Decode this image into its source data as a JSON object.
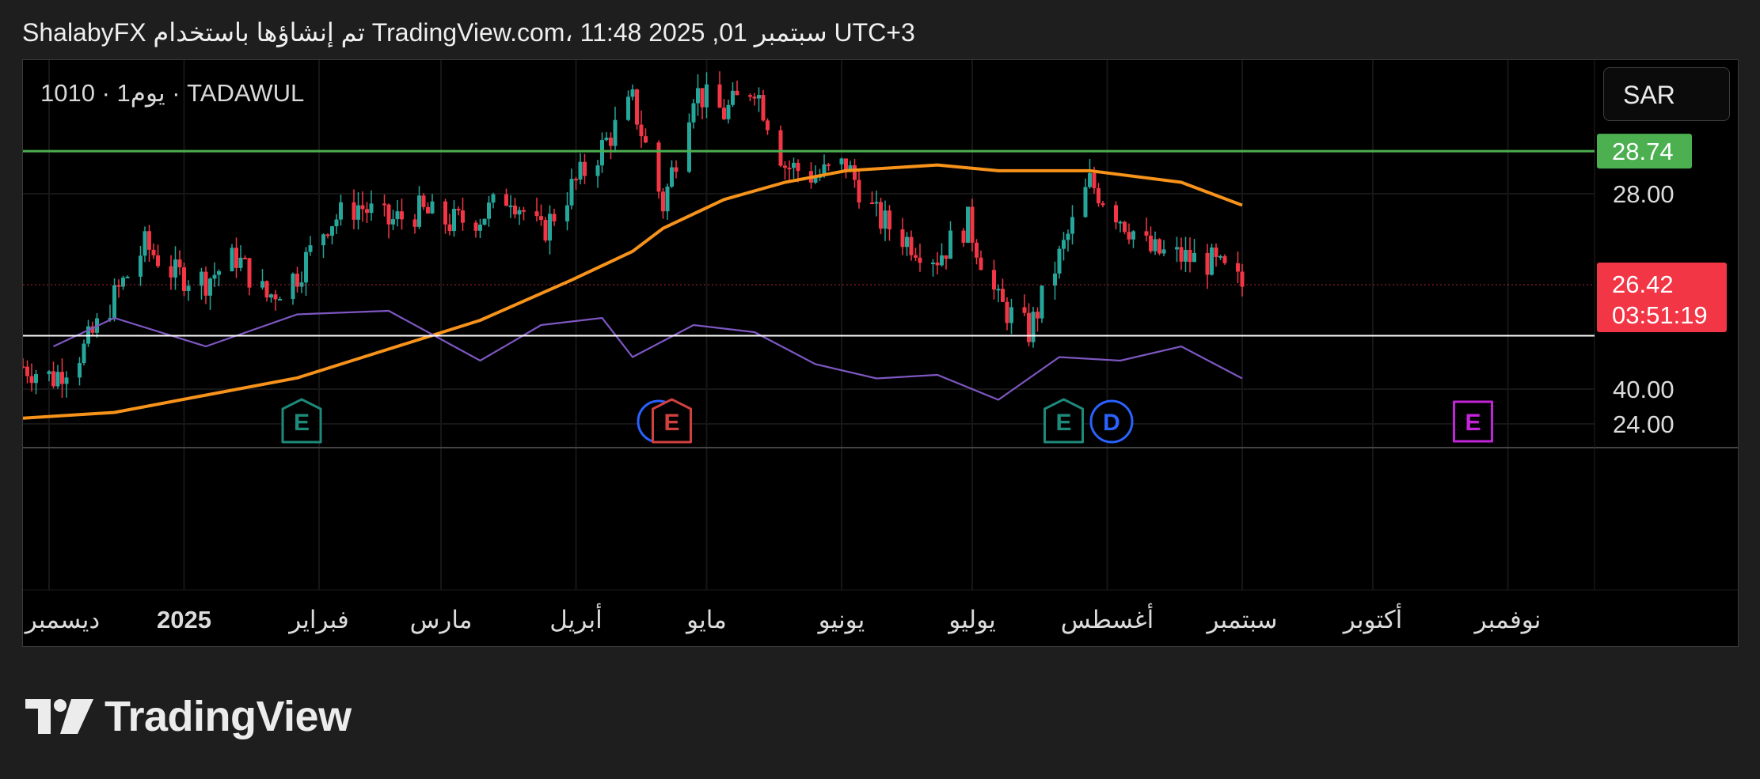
{
  "header": {
    "text": "ShalabyFX تم إنشاؤها باستخدام TradingView.com، 11:48 2025 ,01 سبتمبر UTC+3"
  },
  "symbol_label": "1010 · 1يوم · TADAWUL",
  "currency": "SAR",
  "logo": {
    "text": "TradingView",
    "icon": "tradingview-logo-icon"
  },
  "colors": {
    "up": "#26a69a",
    "down": "#f23645",
    "sma": "#f7931a",
    "rsi": "#7e57c2",
    "resistance": "#4caf50",
    "price_badge": "#f23645",
    "earnings": "#1e8a7a",
    "earnings_down": "#d24040",
    "dividend": "#2962ff",
    "future_earnings": "#c424d9"
  },
  "chart_data": {
    "type": "candlestick",
    "timeframe": "1D",
    "x_tick_labels": [
      "ديسمبر",
      "2025",
      "فبراير",
      "مارس",
      "أبريل",
      "مايو",
      "يونيو",
      "يوليو",
      "أغسطس",
      "سبتمبر",
      "أكتوبر",
      "نوفمبر"
    ],
    "y_tick_labels": [
      "28.00",
      "24.00"
    ],
    "rsi_tick_labels": [
      "40.00"
    ],
    "resistance_line": {
      "value": 28.74,
      "label": "28.74"
    },
    "last_price": {
      "value": 26.42,
      "label": "26.42",
      "countdown": "03:51:19"
    },
    "series_outline": [
      {
        "date": "2024-11-25",
        "close": 25.0
      },
      {
        "date": "2024-12-02",
        "close": 24.8
      },
      {
        "date": "2024-12-09",
        "close": 25.3
      },
      {
        "date": "2024-12-16",
        "close": 26.2
      },
      {
        "date": "2024-12-23",
        "close": 27.1
      },
      {
        "date": "2024-12-30",
        "close": 26.6
      },
      {
        "date": "2025-01-06",
        "close": 26.5
      },
      {
        "date": "2025-01-13",
        "close": 26.9
      },
      {
        "date": "2025-01-20",
        "close": 26.2
      },
      {
        "date": "2025-01-27",
        "close": 26.6
      },
      {
        "date": "2025-02-03",
        "close": 27.5
      },
      {
        "date": "2025-02-10",
        "close": 27.8
      },
      {
        "date": "2025-02-17",
        "close": 27.5
      },
      {
        "date": "2025-02-24",
        "close": 27.7
      },
      {
        "date": "2025-03-03",
        "close": 27.5
      },
      {
        "date": "2025-03-10",
        "close": 27.6
      },
      {
        "date": "2025-03-17",
        "close": 28.0
      },
      {
        "date": "2025-03-24",
        "close": 27.3
      },
      {
        "date": "2025-03-31",
        "close": 28.1
      },
      {
        "date": "2025-04-07",
        "close": 28.8
      },
      {
        "date": "2025-04-14",
        "close": 29.6
      },
      {
        "date": "2025-04-21",
        "close": 27.8
      },
      {
        "date": "2025-04-28",
        "close": 29.8
      },
      {
        "date": "2025-05-05",
        "close": 29.4
      },
      {
        "date": "2025-05-12",
        "close": 29.9
      },
      {
        "date": "2025-05-19",
        "close": 28.5
      },
      {
        "date": "2025-05-26",
        "close": 28.3
      },
      {
        "date": "2025-06-02",
        "close": 28.5
      },
      {
        "date": "2025-06-09",
        "close": 27.6
      },
      {
        "date": "2025-06-16",
        "close": 27.2
      },
      {
        "date": "2025-06-23",
        "close": 26.9
      },
      {
        "date": "2025-06-30",
        "close": 27.5
      },
      {
        "date": "2025-07-07",
        "close": 26.1
      },
      {
        "date": "2025-07-14",
        "close": 25.6
      },
      {
        "date": "2025-07-21",
        "close": 26.9
      },
      {
        "date": "2025-07-28",
        "close": 28.2
      },
      {
        "date": "2025-08-04",
        "close": 27.6
      },
      {
        "date": "2025-08-11",
        "close": 27.0
      },
      {
        "date": "2025-08-18",
        "close": 26.9
      },
      {
        "date": "2025-08-25",
        "close": 26.8
      },
      {
        "date": "2025-09-01",
        "close": 26.4
      }
    ],
    "sma": [
      {
        "date": "2024-11-25",
        "value": 24.1
      },
      {
        "date": "2024-12-16",
        "value": 24.2
      },
      {
        "date": "2025-01-06",
        "value": 24.5
      },
      {
        "date": "2025-01-27",
        "value": 24.8
      },
      {
        "date": "2025-02-17",
        "value": 25.3
      },
      {
        "date": "2025-03-10",
        "value": 25.8
      },
      {
        "date": "2025-03-31",
        "value": 26.5
      },
      {
        "date": "2025-04-14",
        "value": 27.0
      },
      {
        "date": "2025-04-21",
        "value": 27.4
      },
      {
        "date": "2025-05-05",
        "value": 27.9
      },
      {
        "date": "2025-05-19",
        "value": 28.2
      },
      {
        "date": "2025-06-02",
        "value": 28.4
      },
      {
        "date": "2025-06-23",
        "value": 28.5
      },
      {
        "date": "2025-07-07",
        "value": 28.4
      },
      {
        "date": "2025-07-28",
        "value": 28.4
      },
      {
        "date": "2025-08-18",
        "value": 28.2
      },
      {
        "date": "2025-09-01",
        "value": 27.8
      }
    ],
    "events": [
      {
        "type": "earnings",
        "label": "E",
        "date": "2025-01-28"
      },
      {
        "type": "dividend",
        "label": "D",
        "date": "2025-04-20"
      },
      {
        "type": "earnings_down",
        "label": "E",
        "date": "2025-04-23"
      },
      {
        "type": "earnings",
        "label": "E",
        "date": "2025-07-22"
      },
      {
        "type": "dividend",
        "label": "D",
        "date": "2025-08-02"
      },
      {
        "type": "future_earnings",
        "label": "E",
        "date": "2025-10-24"
      }
    ],
    "rsi": {
      "reference_line": 55,
      "values": [
        {
          "date": "2024-12-02",
          "value": 52
        },
        {
          "date": "2024-12-16",
          "value": 60
        },
        {
          "date": "2025-01-06",
          "value": 52
        },
        {
          "date": "2025-01-27",
          "value": 61
        },
        {
          "date": "2025-02-17",
          "value": 62
        },
        {
          "date": "2025-03-10",
          "value": 48
        },
        {
          "date": "2025-03-24",
          "value": 58
        },
        {
          "date": "2025-04-07",
          "value": 60
        },
        {
          "date": "2025-04-14",
          "value": 49
        },
        {
          "date": "2025-04-28",
          "value": 58
        },
        {
          "date": "2025-05-12",
          "value": 56
        },
        {
          "date": "2025-05-26",
          "value": 47
        },
        {
          "date": "2025-06-09",
          "value": 43
        },
        {
          "date": "2025-06-23",
          "value": 44
        },
        {
          "date": "2025-07-07",
          "value": 37
        },
        {
          "date": "2025-07-21",
          "value": 49
        },
        {
          "date": "2025-08-04",
          "value": 48
        },
        {
          "date": "2025-08-18",
          "value": 52
        },
        {
          "date": "2025-09-01",
          "value": 43
        }
      ]
    }
  }
}
